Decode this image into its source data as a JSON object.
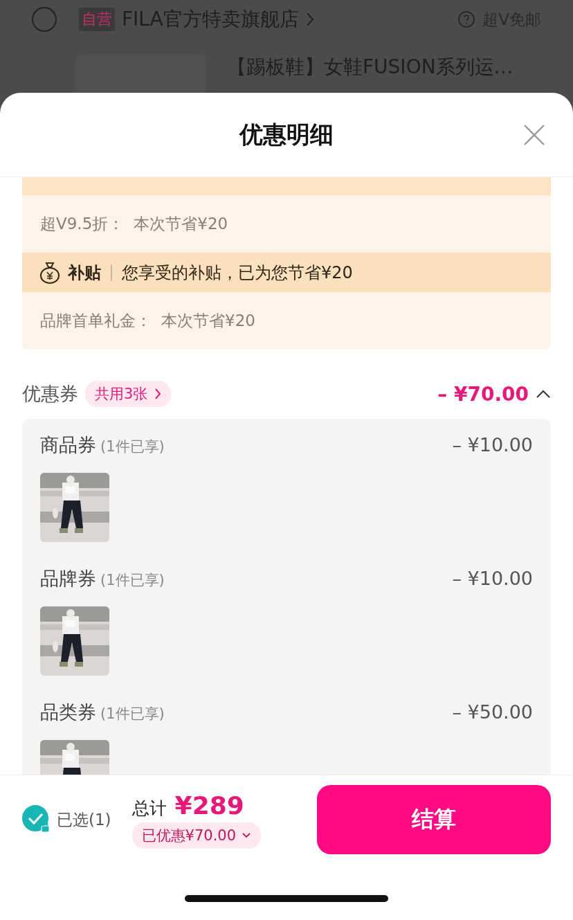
{
  "background_page": {
    "store": {
      "checked": false,
      "tag": "自营",
      "name": "FILA官方特卖旗舰店",
      "shipping": "超V免邮"
    },
    "product": {
      "title": "【踢板鞋】女鞋FUSION系列运…"
    }
  },
  "sheet": {
    "title": "优惠明细"
  },
  "benefits": [
    {
      "kind": "row",
      "label": "超V9.5折：",
      "text": "本次节省¥20"
    },
    {
      "kind": "band",
      "label": "补贴",
      "text": "您享受的补贴，已为您节省¥20"
    },
    {
      "kind": "row",
      "label": "品牌首单礼金：",
      "text": "本次节省¥20"
    }
  ],
  "coupons": {
    "label": "优惠券",
    "badge": "共用3张",
    "total": "– ¥70.00",
    "expanded": true,
    "items": [
      {
        "name": "商品券",
        "note": "(1件已享)",
        "amount": "– ¥10.00"
      },
      {
        "name": "品牌券",
        "note": "(1件已享)",
        "amount": "– ¥10.00"
      },
      {
        "name": "品类券",
        "note": "(1件已享)",
        "amount": "– ¥50.00"
      }
    ]
  },
  "footer": {
    "selected_label": "已选(1)",
    "checked": true,
    "total_label": "总计",
    "total": "¥289",
    "discount": "已优惠¥70.00",
    "checkout": "结算"
  }
}
